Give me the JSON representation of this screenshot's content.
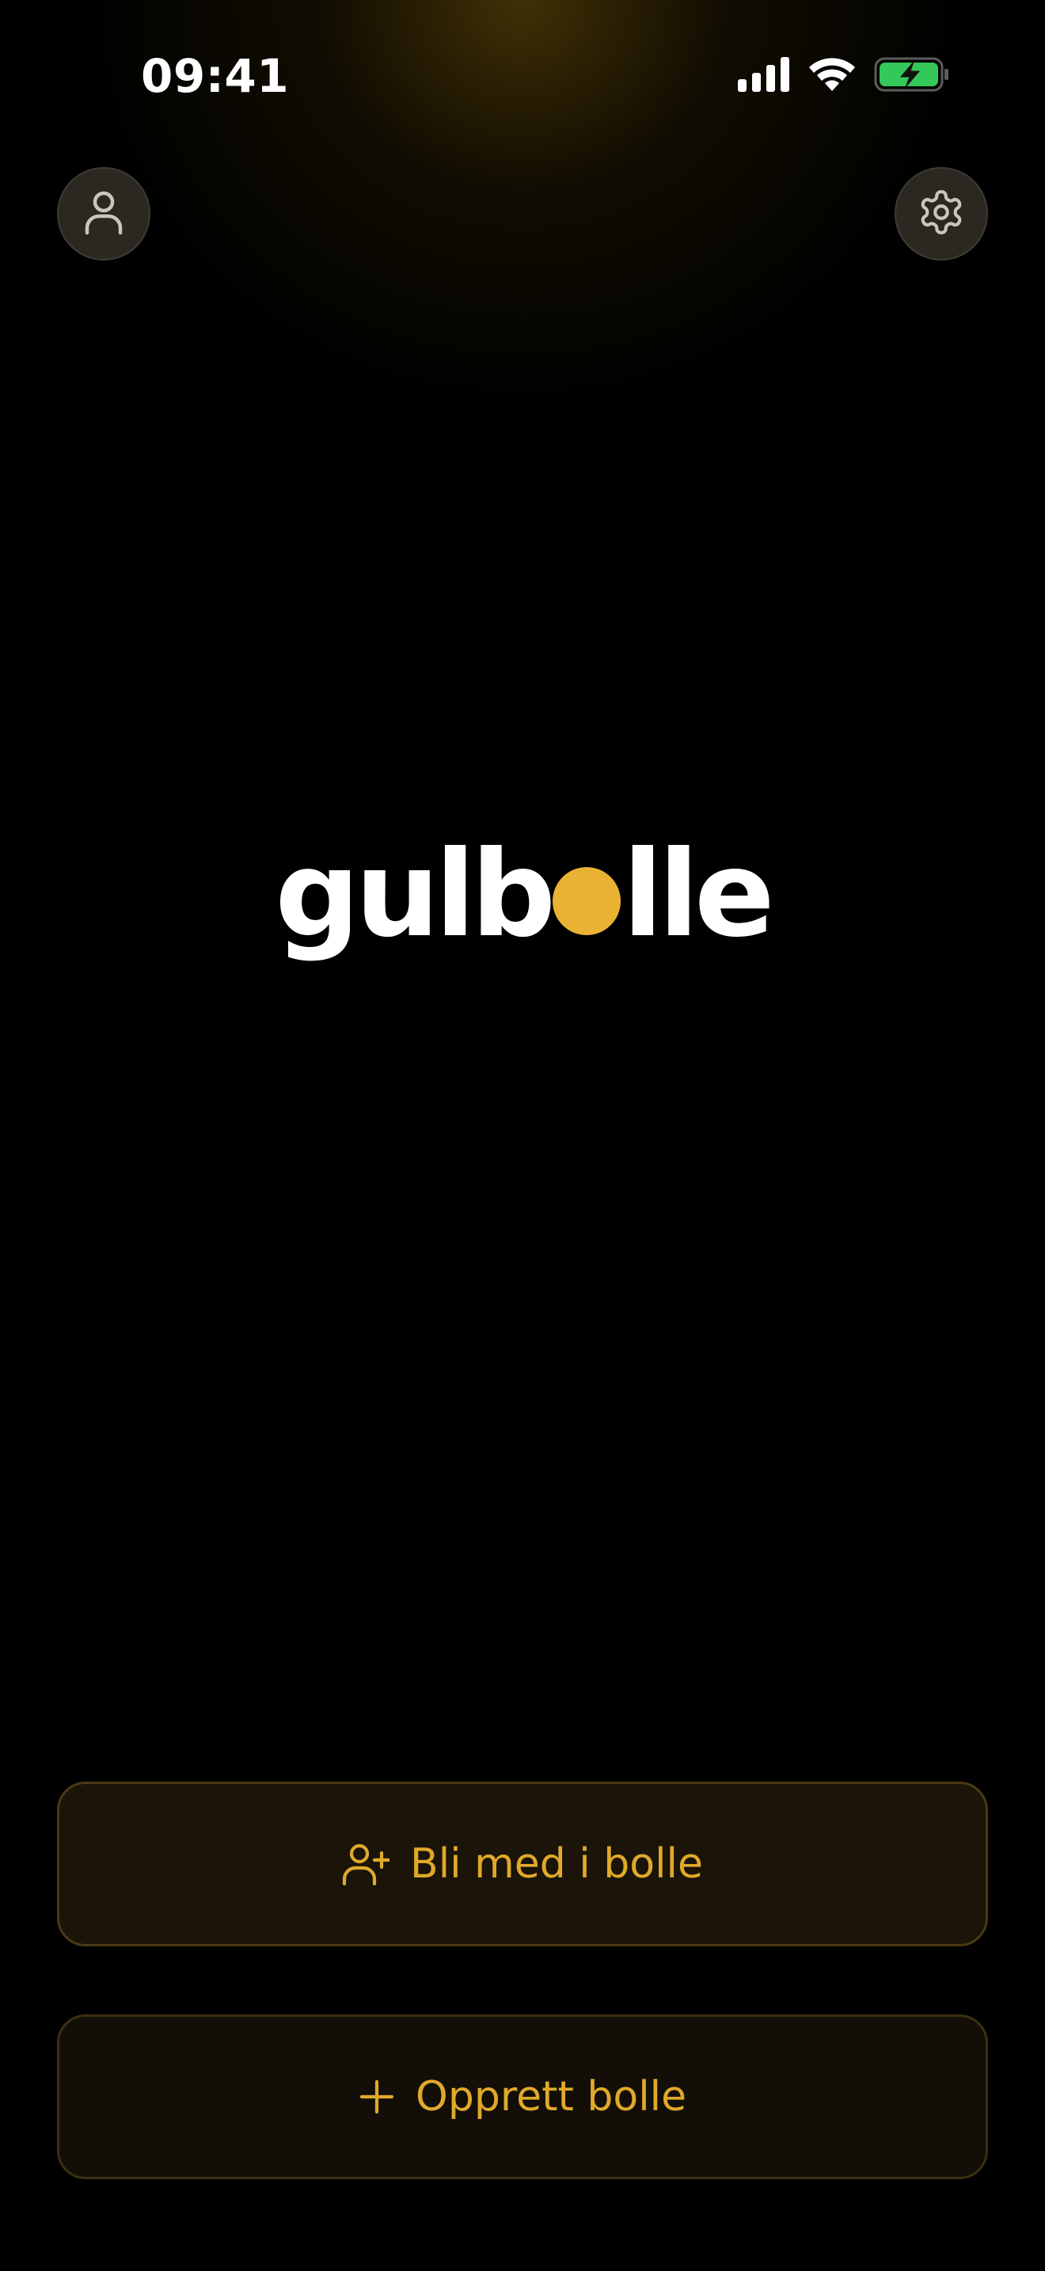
{
  "status_bar": {
    "time": "09:41",
    "icons": [
      "signal-icon",
      "wifi-icon",
      "battery-charging-icon"
    ]
  },
  "header": {
    "left_button_icon": "user-icon",
    "right_button_icon": "gear-icon"
  },
  "logo": {
    "prefix": "gulb",
    "suffix": "lle",
    "dot_color": "#e9b233"
  },
  "actions": {
    "join": {
      "label": "Bli med i bolle",
      "icon": "user-plus-icon"
    },
    "create": {
      "label": "Opprett bolle",
      "icon": "plus-icon"
    }
  },
  "colors": {
    "accent": "#e0a92a",
    "background": "#000000",
    "battery": "#34c759"
  }
}
